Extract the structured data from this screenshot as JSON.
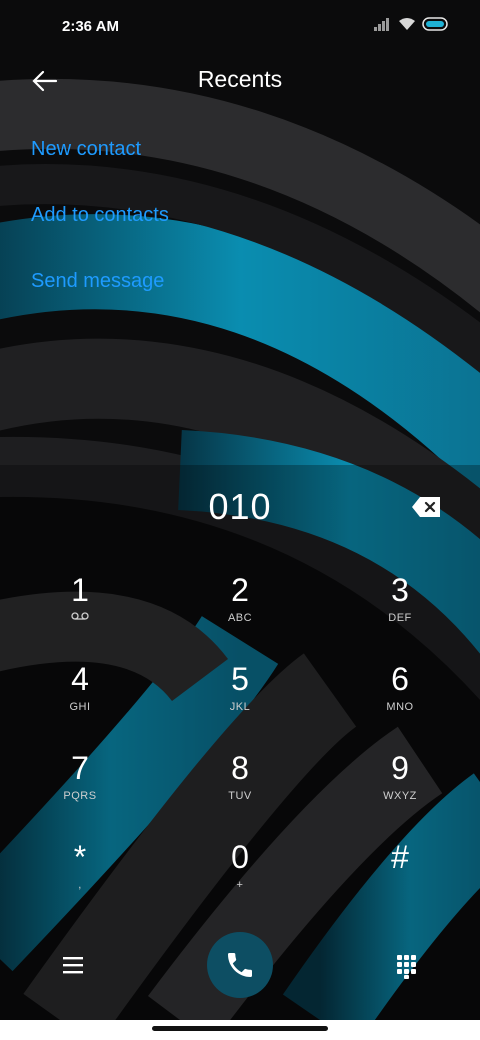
{
  "status_bar": {
    "time": "2:36 AM",
    "icons": [
      "signal-icon",
      "wifi-icon",
      "battery-icon"
    ]
  },
  "header": {
    "title": "Recents",
    "back_icon": "back-arrow-icon"
  },
  "menu": {
    "items": [
      {
        "label": "New contact"
      },
      {
        "label": "Add to contacts"
      },
      {
        "label": "Send message"
      }
    ]
  },
  "dialer": {
    "number": "010",
    "keys": [
      {
        "digit": "1",
        "letters": ""
      },
      {
        "digit": "2",
        "letters": "ABC"
      },
      {
        "digit": "3",
        "letters": "DEF"
      },
      {
        "digit": "4",
        "letters": "GHI"
      },
      {
        "digit": "5",
        "letters": "JKL"
      },
      {
        "digit": "6",
        "letters": "MNO"
      },
      {
        "digit": "7",
        "letters": "PQRS"
      },
      {
        "digit": "8",
        "letters": "TUV"
      },
      {
        "digit": "9",
        "letters": "WXYZ"
      },
      {
        "digit": "*",
        "letters": ","
      },
      {
        "digit": "0",
        "letters": "+"
      },
      {
        "digit": "#",
        "letters": ""
      }
    ]
  },
  "bottom_bar": {
    "icons": [
      "menu-icon",
      "phone-icon",
      "dialpad-icon"
    ]
  },
  "colors": {
    "accent": "#1e9bff",
    "call_button": "#0d4e63",
    "wallpaper_blue": "#0a8db0"
  }
}
